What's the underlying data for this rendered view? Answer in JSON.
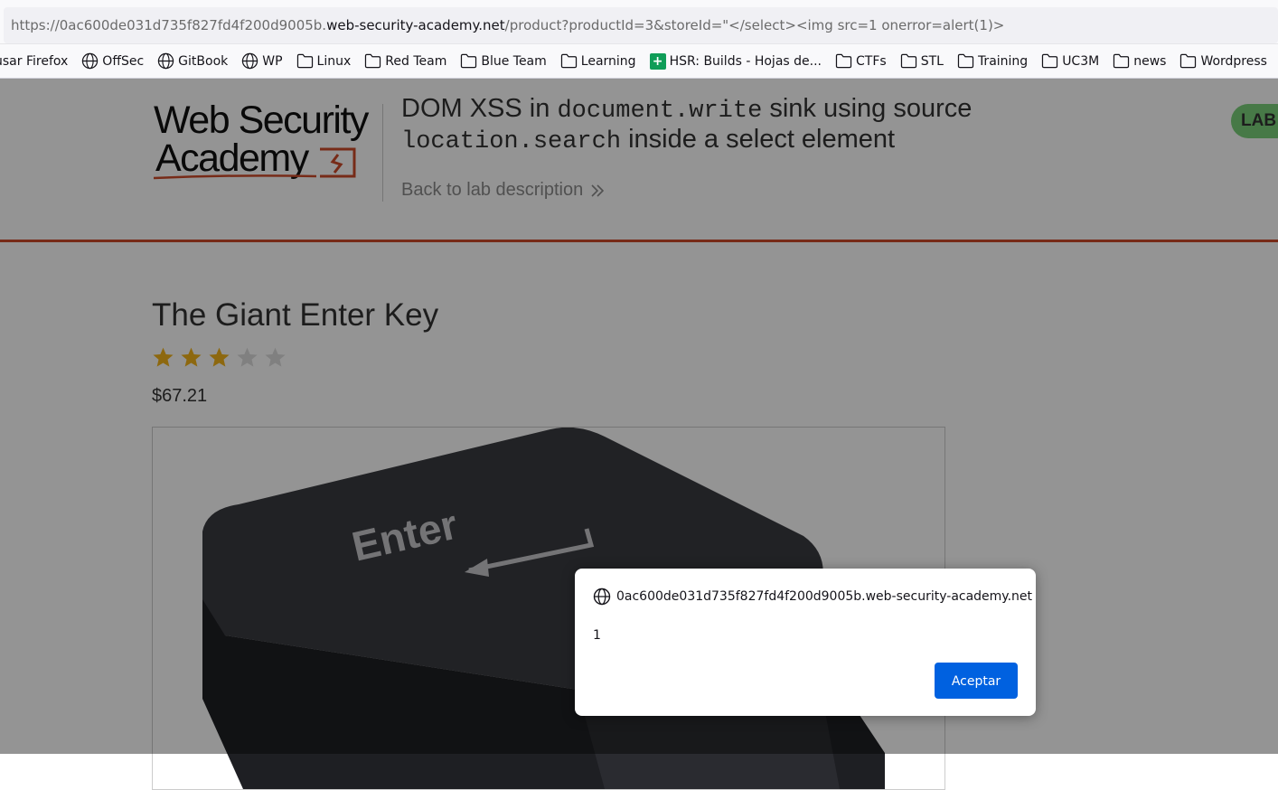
{
  "browser": {
    "url_prefix": "https://0ac600de031d735f827fd4f200d9005b.",
    "url_host": "web-security-academy.net",
    "url_path": "/product?productId=3&storeId=\"</select><img src=1 onerror=alert(1)>",
    "bookmarks": [
      {
        "label": "usar Firefox",
        "icon": "none"
      },
      {
        "label": "OffSec",
        "icon": "globe-icon"
      },
      {
        "label": "GitBook",
        "icon": "globe-icon"
      },
      {
        "label": "WP",
        "icon": "globe-icon"
      },
      {
        "label": "Linux",
        "icon": "folder-icon"
      },
      {
        "label": "Red Team",
        "icon": "folder-icon"
      },
      {
        "label": "Blue Team",
        "icon": "folder-icon"
      },
      {
        "label": "Learning",
        "icon": "folder-icon"
      },
      {
        "label": "HSR: Builds - Hojas de...",
        "icon": "sheets-icon"
      },
      {
        "label": "CTFs",
        "icon": "folder-icon"
      },
      {
        "label": "STL",
        "icon": "folder-icon"
      },
      {
        "label": "Training",
        "icon": "folder-icon"
      },
      {
        "label": "UC3M",
        "icon": "folder-icon"
      },
      {
        "label": "news",
        "icon": "folder-icon"
      },
      {
        "label": "Wordpress",
        "icon": "folder-icon"
      }
    ]
  },
  "header": {
    "logo_line1": "Web Security",
    "logo_line2": "Academy",
    "title_part1": "DOM XSS in ",
    "title_code1": "document.write",
    "title_part2": " sink using source",
    "title_code2": "location.search",
    "title_part3": " inside a select element",
    "back_link": "Back to lab description",
    "lab_badge": "LAB",
    "accent_color": "#ce4b2a"
  },
  "product": {
    "title": "The Giant Enter Key",
    "rating": 3,
    "rating_max": 5,
    "price": "$67.21",
    "image_key_text": "Enter"
  },
  "dialog": {
    "origin": "0ac600de031d735f827fd4f200d9005b.web-security-academy.net",
    "message": "1",
    "button": "Aceptar"
  }
}
